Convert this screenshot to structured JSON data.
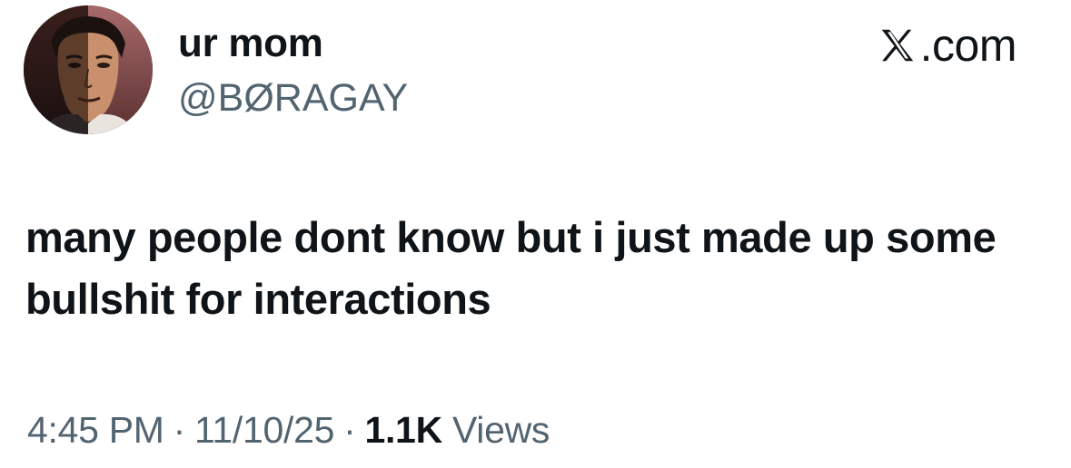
{
  "author": {
    "display_name": "ur mom",
    "handle": "@BØRAGAY"
  },
  "brand": {
    "icon": "x-logo-icon",
    "text": ".com"
  },
  "tweet": {
    "text": "many people dont know but i just made up some bullshit for interactions"
  },
  "meta": {
    "time": "4:45 PM",
    "separator": "·",
    "date": "11/10/25",
    "views_count": "1.1K",
    "views_label": "Views"
  },
  "colors": {
    "primary_text": "#0f1419",
    "secondary_text": "#536471",
    "background": "#ffffff"
  }
}
